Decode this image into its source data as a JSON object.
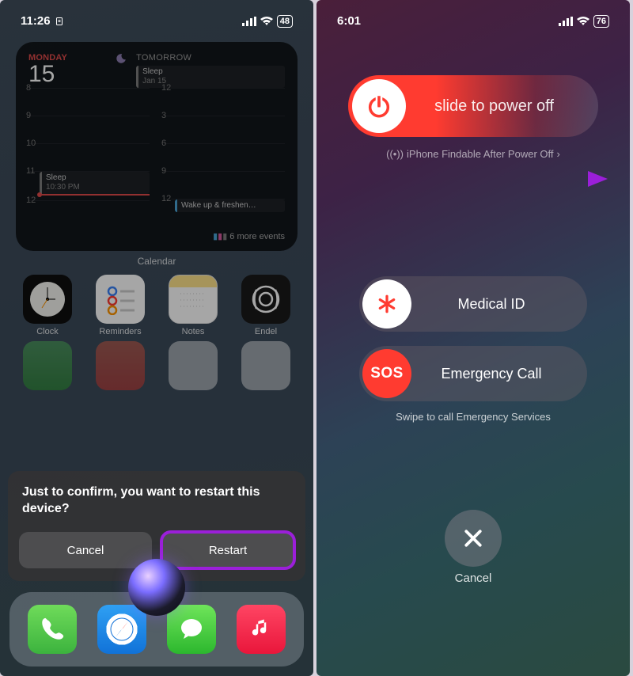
{
  "left": {
    "status": {
      "time": "11:26",
      "battery": "48"
    },
    "widget": {
      "day_name": "MONDAY",
      "day_number": "15",
      "tomorrow_label": "TOMORROW",
      "sleep_label": "Sleep",
      "sleep_date": "Jan 15",
      "event_sleep": "Sleep",
      "event_sleep_time": "10:30 PM",
      "wake_label": "Wake up & freshen…",
      "more_events": "6 more events"
    },
    "calendar_label": "Calendar",
    "apps": {
      "clock": "Clock",
      "reminders": "Reminders",
      "notes": "Notes",
      "endel": "Endel"
    },
    "sheet": {
      "title": "Just to confirm, you want to restart this device?",
      "cancel": "Cancel",
      "restart": "Restart"
    }
  },
  "right": {
    "status": {
      "time": "6:01",
      "battery": "76"
    },
    "power_slider": "slide to power off",
    "findable": "iPhone Findable After Power Off",
    "medical": "Medical ID",
    "sos": "Emergency Call",
    "sos_glyph": "SOS",
    "swipe_caption": "Swipe to call Emergency Services",
    "cancel": "Cancel"
  }
}
